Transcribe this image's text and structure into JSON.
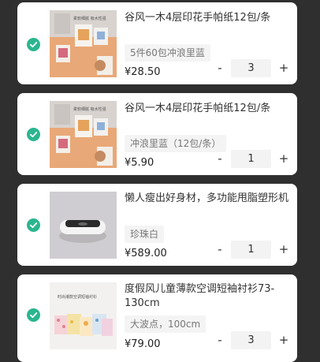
{
  "cart": {
    "items": [
      {
        "title": "谷风一木4层印花手帕纸12包/条",
        "sku": "5件60包冲浪里蓝",
        "price": "¥28.50",
        "quantity": "3",
        "minus": "-",
        "plus": "+"
      },
      {
        "title": "谷风一木4层印花手帕纸12包/条",
        "sku": "冲浪里蓝（12包/条）",
        "price": "¥5.90",
        "quantity": "1",
        "minus": "-",
        "plus": "+"
      },
      {
        "title": "懒人瘦出好身材，多功能甩脂塑形机",
        "sku": "珍珠白",
        "price": "¥589.00",
        "quantity": "1",
        "minus": "-",
        "plus": "+"
      },
      {
        "title": "度假风儿童薄款空调短袖衬衫73-130cm",
        "sku": "大波点，100cm",
        "price": "¥79.00",
        "quantity": "3",
        "minus": "-",
        "plus": "+"
      }
    ],
    "thumb_text": {
      "tissue": "柔软细腻 吸水性强",
      "shirt": "时尚潮款空调短袖衬衫"
    }
  },
  "colors": {
    "page_background": "#2f2f2f",
    "card_background": "#ffffff",
    "check_green": "#2bb58f"
  },
  "icons": {
    "selected": "check-circle-icon"
  }
}
